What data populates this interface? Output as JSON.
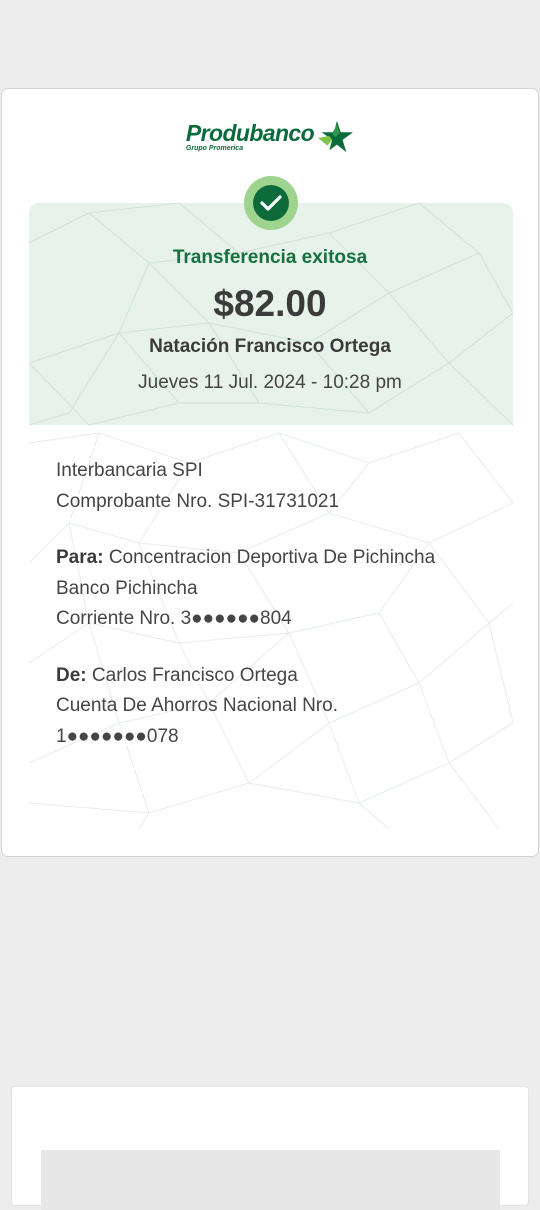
{
  "brand": {
    "name": "Produbanco",
    "tagline": "Grupo Promerica",
    "color": "#0c6b3a",
    "star_color": "#0c6b3a",
    "star_accent": "#7cc44a"
  },
  "receipt": {
    "status": "Transferencia exitosa",
    "amount": "$82.00",
    "beneficiary_name": "Natación Francisco Ortega",
    "datetime": "Jueves 11 Jul. 2024 - 10:28 pm",
    "transfer_type": "Interbancaria SPI",
    "voucher": "Comprobante Nro. SPI-31731021",
    "to": {
      "label": "Para:",
      "name": "Concentracion Deportiva De Pichincha",
      "bank": "Banco Pichincha",
      "account": "Corriente Nro. 3●●●●●●804"
    },
    "from": {
      "label": "De:",
      "name": "Carlos Francisco Ortega",
      "account_type": "Cuenta De Ahorros Nacional Nro.",
      "account": "1●●●●●●●078"
    }
  },
  "icons": {
    "success": "check-circle-icon"
  },
  "colors": {
    "header_tint": "#e6f2ea",
    "success_ring": "#9fd48e",
    "success_fill": "#0d6b3b",
    "status_text": "#16703f"
  }
}
